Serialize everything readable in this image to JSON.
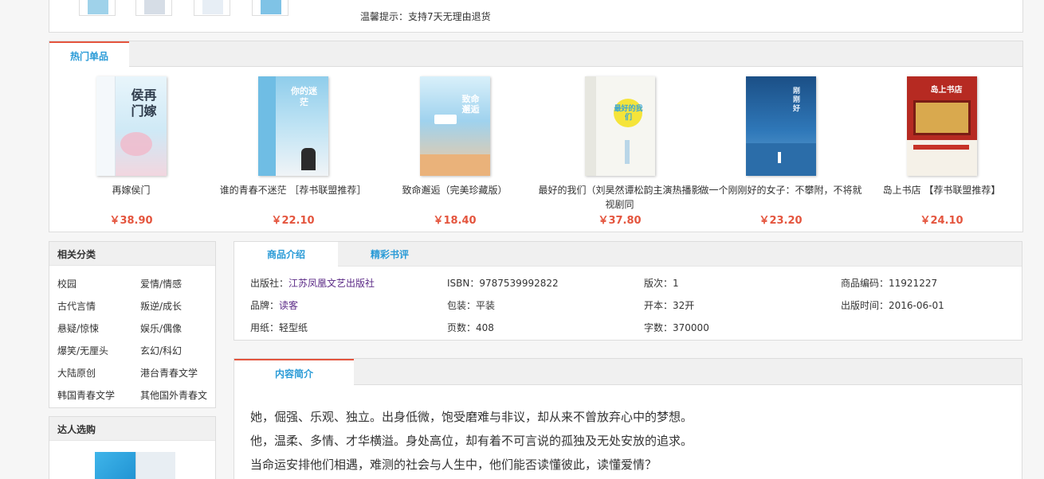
{
  "gallery": {
    "tip": "温馨提示：支持7天无理由退货",
    "thumbs": [
      "#9fd2ea",
      "#d6dde6",
      "#e7eef5",
      "#7fc3e6"
    ]
  },
  "hot": {
    "tab_label": "热门单品",
    "products": [
      {
        "name": "再嫁侯门",
        "price": "￥38.90",
        "cover_title": "侯再门嫁",
        "cover_bg": "#dff0f8"
      },
      {
        "name": "谁的青春不迷茫 ［荐书联盟推荐］",
        "price": "￥22.10",
        "cover_title": "你的迷茫",
        "cover_bg": "#9fd3ee"
      },
      {
        "name": "致命邂逅（完美珍藏版）",
        "price": "￥18.40",
        "cover_title": "致命邂逅",
        "cover_bg": "#bfe2f2"
      },
      {
        "name": "最好的我们（刘昊然谭松韵主演热播影视剧同",
        "price": "￥37.80",
        "cover_title": "最好的我们",
        "cover_bg": "#f4f4ee"
      },
      {
        "name": "做一个刚刚好的女子：不攀附，不将就",
        "price": "￥23.20",
        "cover_title": "刚刚好",
        "cover_bg": "#1f5f9c"
      },
      {
        "name": "岛上书店 【荐书联盟推荐】",
        "price": "￥24.10",
        "cover_title": "岛上书店",
        "cover_bg": "#b82a22"
      }
    ]
  },
  "categories": {
    "title": "相关分类",
    "items": [
      "校园",
      "爱情/情感",
      "古代言情",
      "叛逆/成长",
      "悬疑/惊悚",
      "娱乐/偶像",
      "爆笑/无厘头",
      "玄幻/科幻",
      "大陆原创",
      "港台青春文学",
      "韩国青春文学",
      "其他国外青春文"
    ]
  },
  "expert": {
    "title": "达人选购"
  },
  "info": {
    "tabs": [
      "商品介绍",
      "精彩书评"
    ],
    "specs": [
      {
        "label": "出版社：",
        "value": "江苏凤凰文艺出版社",
        "link": true
      },
      {
        "label": "ISBN：",
        "value": "9787539992822",
        "link": false
      },
      {
        "label": "版次：",
        "value": "1",
        "link": false
      },
      {
        "label": "商品编码：",
        "value": "11921227",
        "link": false
      },
      {
        "label": "品牌：",
        "value": "读客",
        "link": true
      },
      {
        "label": "包装：",
        "value": "平装",
        "link": false
      },
      {
        "label": "开本：",
        "value": "32开",
        "link": false
      },
      {
        "label": "出版时间：",
        "value": "2016-06-01",
        "link": false
      },
      {
        "label": "用纸：",
        "value": "轻型纸",
        "link": false
      },
      {
        "label": "页数：",
        "value": "408",
        "link": false
      },
      {
        "label": "字数：",
        "value": "370000",
        "link": false
      }
    ]
  },
  "description": {
    "tab_label": "内容简介",
    "lines": [
      "她，倔强、乐观、独立。出身低微，饱受磨难与非议，却从来不曾放弃心中的梦想。",
      "他，温柔、多情、才华横溢。身处高位，却有着不可言说的孤独及无处安放的追求。",
      "当命运安排他们相遇，难测的社会与人生中，他们能否读懂彼此，读懂爱情？"
    ]
  }
}
